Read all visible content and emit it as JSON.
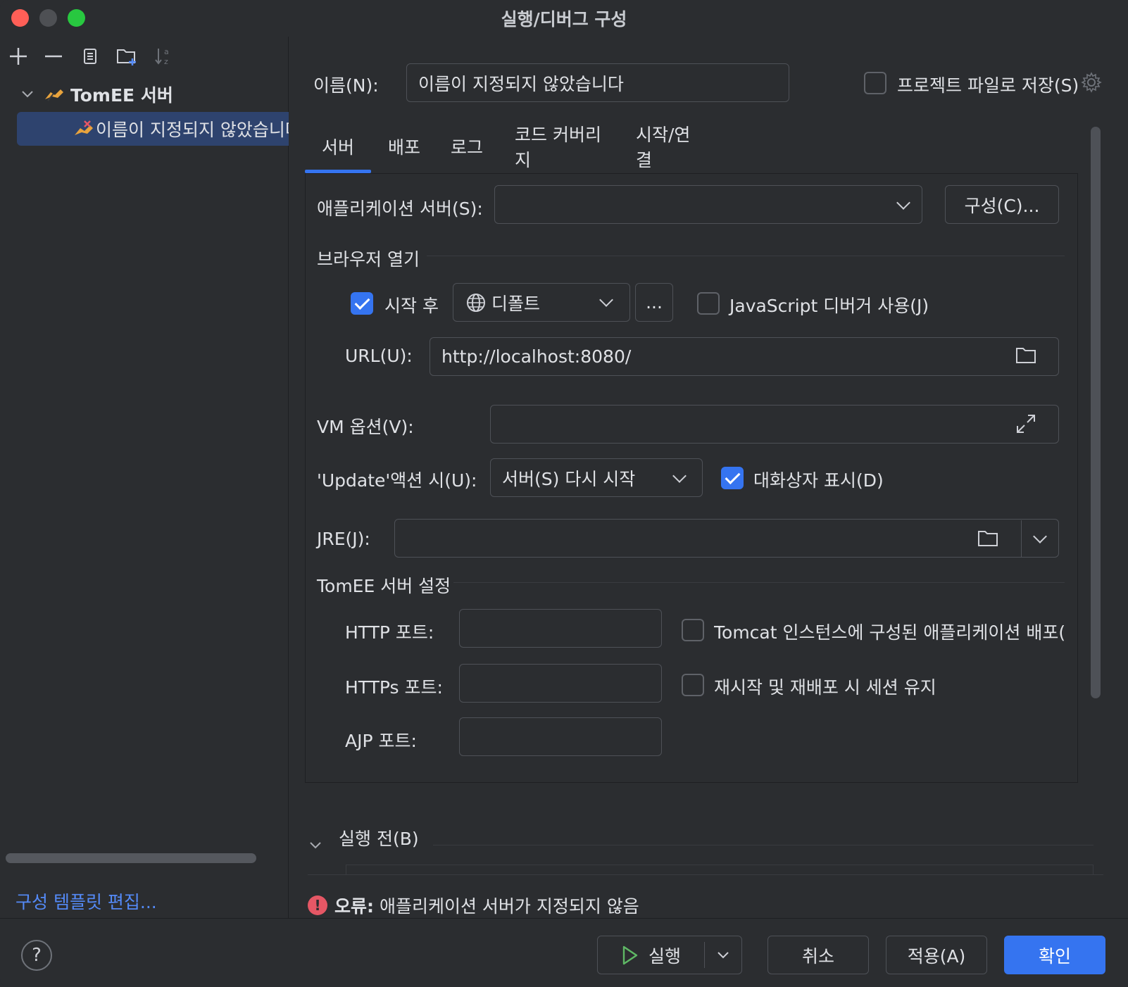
{
  "window": {
    "title": "실행/디버그 구성"
  },
  "sidebar": {
    "toolbar_icons": [
      "add-icon",
      "remove-icon",
      "copy-icon",
      "new-folder-icon",
      "sort-icon"
    ],
    "tree": [
      {
        "label": "TomEE 서버",
        "icon": "tomee-icon",
        "expanded": true
      },
      {
        "label": "이름이 지정되지 않았습니다",
        "icon": "tomee-error-icon",
        "selected": true
      }
    ],
    "edit_templates": "구성 템플릿 편집..."
  },
  "header": {
    "name_label": "이름(N):",
    "name_value": "이름이 지정되지 않았습니다",
    "store_label": "프로젝트 파일로 저장(S)",
    "store_checked": false
  },
  "tabs": [
    "서버",
    "배포",
    "로그",
    "코드 커버리지",
    "시작/연결"
  ],
  "active_tab": "서버",
  "server": {
    "app_server_label": "애플리케이션 서버(S):",
    "app_server_value": "",
    "configure_button": "구성(C)...",
    "open_browser_title": "브라우저 열기",
    "after_launch_label": "시작 후",
    "after_launch_checked": true,
    "browser_value": "디폴트",
    "more_button": "...",
    "js_debugger_label": "JavaScript 디버거 사용(J)",
    "js_debugger_checked": false,
    "url_label": "URL(U):",
    "url_value": "http://localhost:8080/",
    "vm_options_label": "VM 옵션(V):",
    "vm_options_value": "",
    "update_action_label": "'Update'액션 시(U):",
    "update_action_value": "서버(S) 다시 시작",
    "show_dialog_label": "대화상자 표시(D)",
    "show_dialog_checked": true,
    "jre_label": "JRE(J):",
    "jre_value": "",
    "tomee_settings_title": "TomEE 서버 설정",
    "http_port_label": "HTTP 포트:",
    "https_port_label": "HTTPs 포트:",
    "ajp_port_label": "AJP 포트:",
    "deploy_configured_label": "Tomcat 인스턴스에 구성된 애플리케이션 배포(",
    "preserve_sessions_label": "재시작 및 재배포 시 세션 유지"
  },
  "before_launch": {
    "title": "실행 전(B)"
  },
  "error": {
    "prefix": "오류:",
    "message": " 애플리케이션 서버가 지정되지 않음"
  },
  "footer": {
    "help": "?",
    "run_button": "실행",
    "cancel_button": "취소",
    "apply_button": "적용(A)",
    "ok_button": "확인"
  },
  "colors": {
    "accent": "#3574f0",
    "background": "#2b2d30",
    "error": "#e55765",
    "link": "#548af7"
  }
}
